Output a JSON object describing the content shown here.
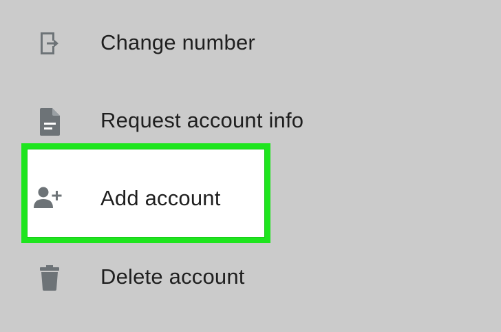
{
  "menu": {
    "items": [
      {
        "label": "Change number",
        "icon": "change-number-icon"
      },
      {
        "label": "Request account info",
        "icon": "document-icon"
      },
      {
        "label": "Add account",
        "icon": "add-person-icon",
        "highlighted": true
      },
      {
        "label": "Delete account",
        "icon": "trash-icon"
      }
    ]
  },
  "colors": {
    "background": "#cbcbcb",
    "highlight_border": "#1ee51e",
    "highlight_fill": "#ffffff",
    "icon": "#6d7377",
    "text": "#1f1f1f"
  }
}
